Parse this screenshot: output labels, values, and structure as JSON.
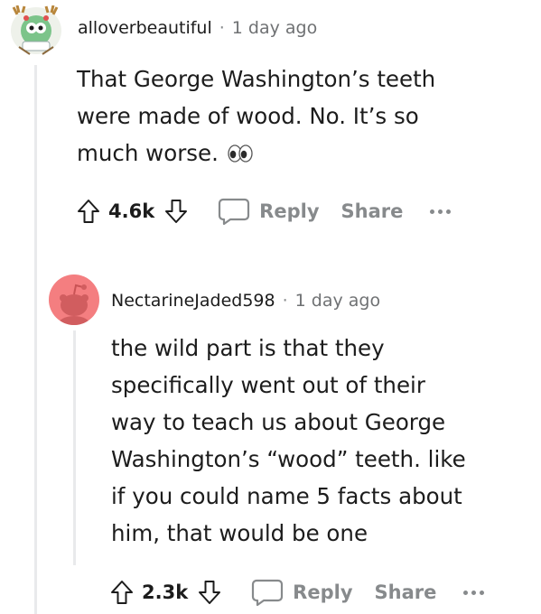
{
  "comments": [
    {
      "username": "alloverbeautiful",
      "separator": "·",
      "time": "1 day ago",
      "body_lines": [
        "That George Washington’s teeth",
        "were made of wood. No. It’s so",
        "much worse."
      ],
      "votes": "4.6k",
      "reply_label": "Reply",
      "share_label": "Share"
    },
    {
      "username": "NectarineJaded598",
      "separator": "·",
      "time": "1 day ago",
      "body_lines": [
        "the wild part is that they",
        "specifically went out of their",
        "way to teach us about George",
        "Washington’s “wood” teeth. like",
        "if you could name 5 facts about",
        "him, that would be one"
      ],
      "votes": "2.3k",
      "reply_label": "Reply",
      "share_label": "Share"
    }
  ],
  "icons": {
    "upvote": "arrow-up-icon",
    "downvote": "arrow-down-icon",
    "reply": "speech-bubble-icon",
    "more": "ellipsis-icon",
    "eyes": "eyes-emoji-icon"
  },
  "colors": {
    "meta_gray": "#878a8c",
    "text": "#1c1c1c",
    "thread_line": "#e9eaec",
    "avatar2_bg": "#f47e80"
  }
}
